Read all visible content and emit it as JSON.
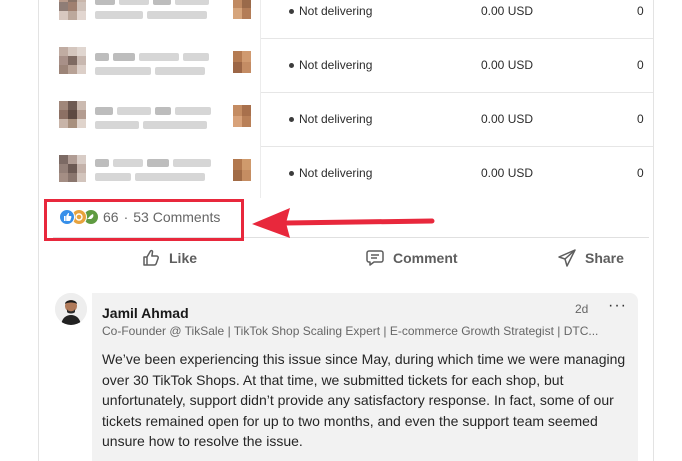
{
  "table": {
    "rows": [
      {
        "status": "Not delivering",
        "amount": "0.00 USD",
        "count": "0"
      },
      {
        "status": "Not delivering",
        "amount": "0.00 USD",
        "count": "0"
      },
      {
        "status": "Not delivering",
        "amount": "0.00 USD",
        "count": "0"
      },
      {
        "status": "Not delivering",
        "amount": "0.00 USD",
        "count": "0"
      }
    ]
  },
  "post": {
    "reaction_count": "66",
    "separator": "·",
    "comments_label": "53 Comments",
    "reaction_icons": [
      "like-icon",
      "celebrate-icon",
      "support-icon"
    ]
  },
  "actions": {
    "like": "Like",
    "comment": "Comment",
    "share": "Share"
  },
  "comment": {
    "author": "Jamil Ahmad",
    "time": "2d",
    "more": "···",
    "headline": "Co-Founder @ TikSale | TikTok Shop Scaling Expert | E-commerce Growth Strategist | DTC...",
    "body": "We’ve been experiencing this issue since May, during which time we were managing over 30 TikTok Shops. At that time, we submitted tickets for each shop, but unfortunately, support didn’t provide any satisfactory response. In fact, some of our tickets remained open for up to two months, and even the support team seemed unsure how to resolve the issue."
  },
  "colors": {
    "highlight": "#e8283c",
    "like": "#378fe9",
    "celebrate": "#e7a33e",
    "support": "#5f9b41"
  }
}
